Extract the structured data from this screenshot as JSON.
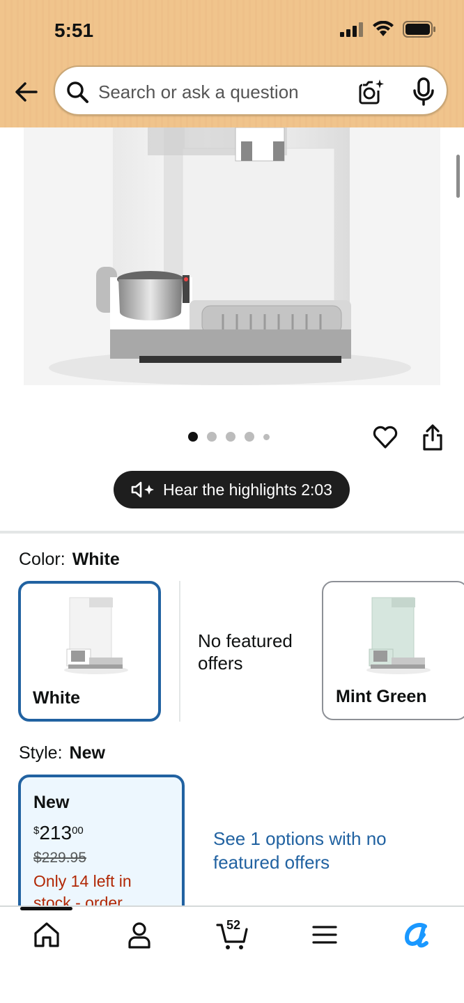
{
  "status_bar": {
    "time": "5:51"
  },
  "search": {
    "placeholder": "Search or ask a question"
  },
  "gallery": {
    "image_count": 5,
    "active_index": 0
  },
  "audio": {
    "label": "Hear the highlights 2:03"
  },
  "color": {
    "label": "Color:",
    "selected": "White",
    "options": [
      {
        "name": "White",
        "selected": true
      },
      {
        "name": "No featured offers"
      },
      {
        "name": "Mint Green",
        "selected": false
      }
    ]
  },
  "style": {
    "label": "Style:",
    "selected": "New",
    "card": {
      "title": "New",
      "price_currency": "$",
      "price_whole": "213",
      "price_fraction": "00",
      "list_price": "$229.95",
      "stock": "Only 14 left in stock - order..."
    },
    "see_options": "See 1 options with no featured offers"
  },
  "bottom_nav": {
    "cart_count": "52",
    "items": [
      "home",
      "account",
      "cart",
      "menu",
      "rufus"
    ]
  },
  "colors": {
    "accent_blue": "#2162a1",
    "stock_red": "#b12704",
    "header_orange": "#f0c48c",
    "rufus_blue": "#1a98ff"
  }
}
